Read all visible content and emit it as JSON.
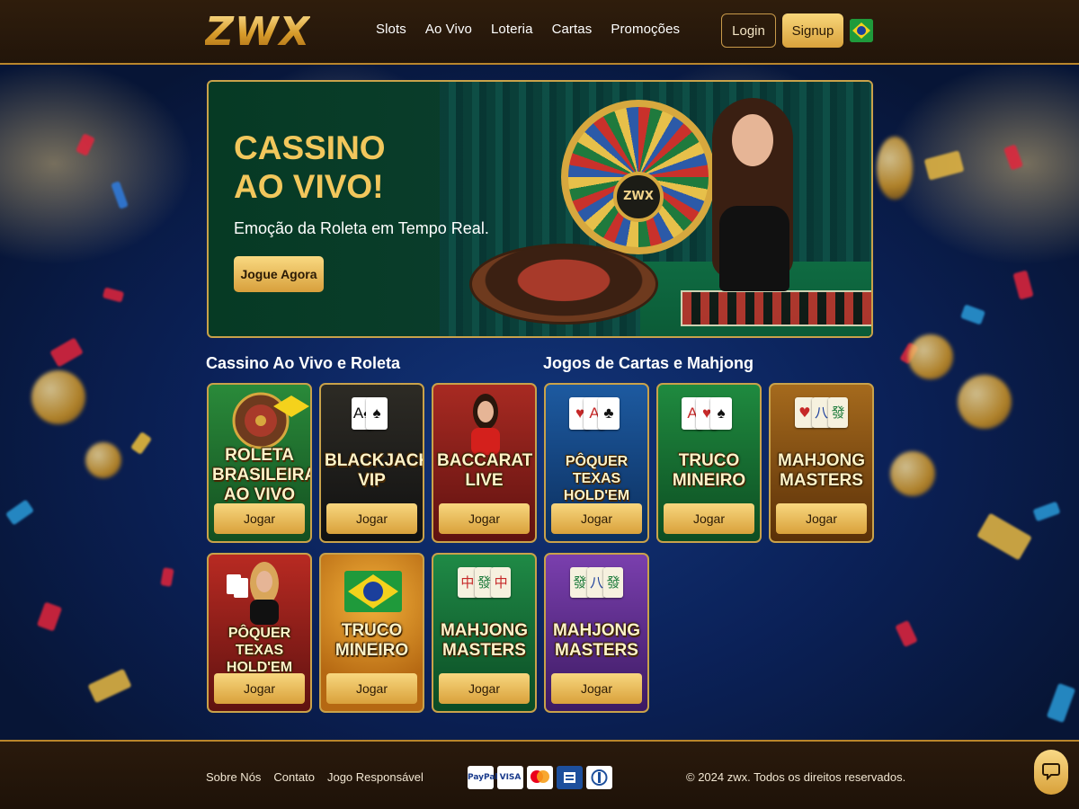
{
  "brand": {
    "logo_text": "ZWX"
  },
  "nav": {
    "items": [
      {
        "label": "Slots"
      },
      {
        "label": "Ao Vivo"
      },
      {
        "label": "Loteria"
      },
      {
        "label": "Cartas"
      },
      {
        "label": "Promoções"
      }
    ],
    "login_label": "Login",
    "signup_label": "Signup",
    "language_flag": "brazil-flag-icon"
  },
  "hero": {
    "title_line1": "CASSINO",
    "title_line2": "AO VIVO!",
    "subtitle": "Emoção da Roleta em Tempo Real.",
    "cta_label": "Jogue Agora",
    "wheel_logo": "ZWX"
  },
  "sections": {
    "live": {
      "title": "Cassino Ao Vivo e Roleta"
    },
    "cards": {
      "title": "Jogos de Cartas e Mahjong"
    }
  },
  "games": [
    {
      "name": "ROLETA BRASILEIRA AO VIVO",
      "play_label": "Jogar",
      "theme": "#1f6b2d"
    },
    {
      "name": "BLACKJACK VIP",
      "play_label": "Jogar",
      "theme": "#1b1b1b"
    },
    {
      "name": "BACCARAT LIVE",
      "play_label": "Jogar",
      "theme": "#8c1e1e"
    },
    {
      "name": "PÔQUER TEXAS HOLD'EM",
      "play_label": "Jogar",
      "theme": "#15407a"
    },
    {
      "name": "TRUCO MINEIRO",
      "play_label": "Jogar",
      "theme": "#176b34"
    },
    {
      "name": "MAHJONG MASTERS",
      "play_label": "Jogar",
      "theme": "#7a4612"
    },
    {
      "name": "PÔQUER TEXAS HOLD'EM",
      "play_label": "Jogar",
      "theme": "#8e1c1c"
    },
    {
      "name": "TRUCO MINEIRO",
      "play_label": "Jogar",
      "theme": "#c9821f"
    },
    {
      "name": "MAHJONG MASTERS",
      "play_label": "Jogar",
      "theme": "#166b3a"
    },
    {
      "name": "MAHJONG MASTERS",
      "play_label": "Jogar",
      "theme": "#5b2a86"
    }
  ],
  "footer": {
    "links": [
      {
        "label": "Sobre Nós"
      },
      {
        "label": "Contato"
      },
      {
        "label": "Jogo Responsável"
      }
    ],
    "payments": [
      "PayPal",
      "VISA",
      "mastercard-icon",
      "bank-card-icon",
      "diners-icon"
    ],
    "paypal_label": "PayPal",
    "visa_label": "VISA",
    "copyright": "© 2024 zwx. Todos os direitos reservados."
  },
  "colors": {
    "gold": "#d9a23c",
    "header_bg": "#2f1d0c",
    "page_bg": "#0b2158"
  }
}
